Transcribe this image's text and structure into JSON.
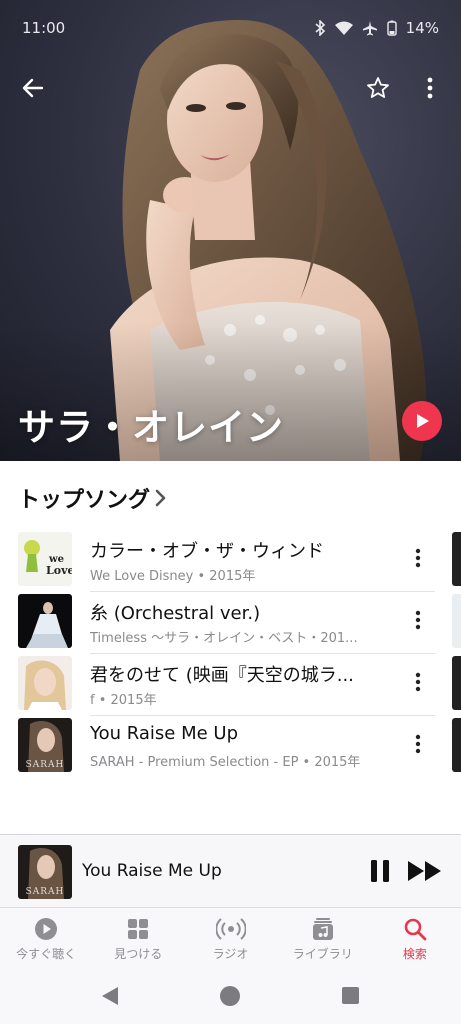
{
  "status_bar": {
    "time": "11:00",
    "battery": "14%"
  },
  "artist": {
    "name": "サラ・オレイン"
  },
  "colors": {
    "accent": "#f0364f",
    "tab_active": "#e8364b"
  },
  "top_songs": {
    "title": "トップソング",
    "items": [
      {
        "title": "カラー・オブ・ザ・ウィンド",
        "subtitle": "We Love Disney • 2015年"
      },
      {
        "title": "糸 (Orchestral ver.)",
        "subtitle": "Timeless 〜サラ・オレイン・ベスト・201..."
      },
      {
        "title": "君をのせて (映画『天空の城ラ...",
        "subtitle": "f • 2015年"
      },
      {
        "title": "You Raise Me Up",
        "subtitle": "SARAH - Premium Selection - EP • 2015年"
      }
    ]
  },
  "now_playing": {
    "title": "You Raise Me Up",
    "art_text": "SARAH"
  },
  "tabs": [
    {
      "label": "今すぐ聴く",
      "icon": "play-circle-icon"
    },
    {
      "label": "見つける",
      "icon": "grid-icon"
    },
    {
      "label": "ラジオ",
      "icon": "radio-icon"
    },
    {
      "label": "ライブラリ",
      "icon": "library-icon"
    },
    {
      "label": "検索",
      "icon": "search-icon"
    }
  ]
}
